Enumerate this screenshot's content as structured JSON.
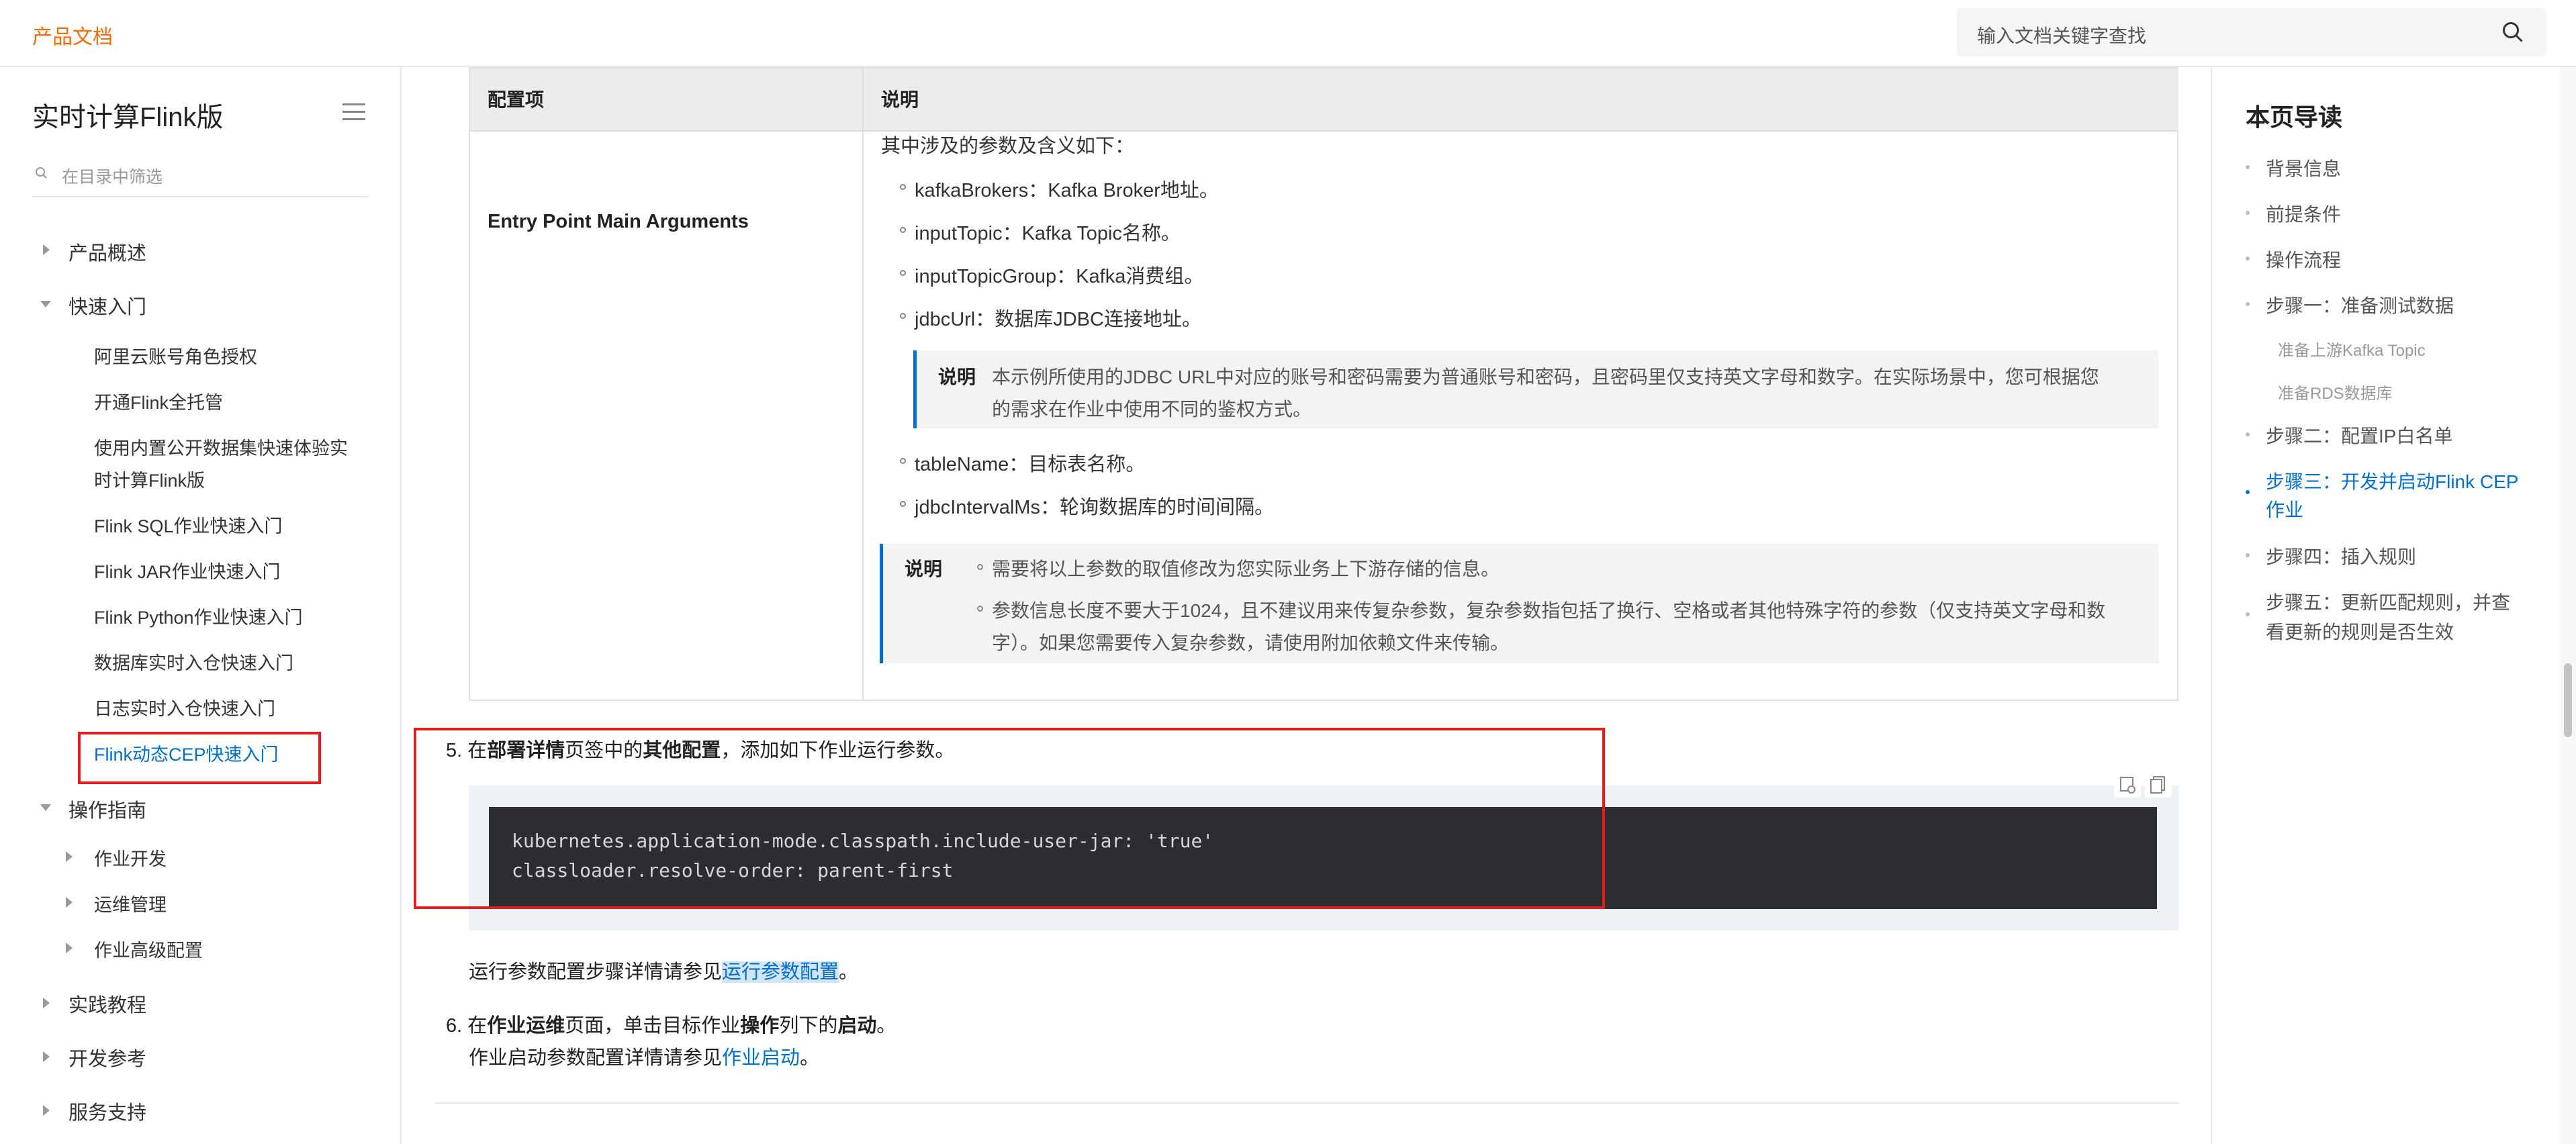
{
  "topbar": {
    "brand": "产品文档",
    "search_placeholder": "输入文档关键字查找"
  },
  "sidebar": {
    "title": "实时计算Flink版",
    "filter_placeholder": "在目录中筛选",
    "items": [
      {
        "label": "产品概述"
      },
      {
        "label": "快速入门"
      },
      {
        "label": "阿里云账号角色授权"
      },
      {
        "label": "开通Flink全托管"
      },
      {
        "label": "使用内置公开数据集快速体验实"
      },
      {
        "label": "时计算Flink版"
      },
      {
        "label": "Flink SQL作业快速入门"
      },
      {
        "label": "Flink JAR作业快速入门"
      },
      {
        "label": "Flink Python作业快速入门"
      },
      {
        "label": "数据库实时入仓快速入门"
      },
      {
        "label": "日志实时入仓快速入门"
      },
      {
        "label": "Flink动态CEP快速入门"
      },
      {
        "label": "操作指南"
      },
      {
        "label": "作业开发"
      },
      {
        "label": "运维管理"
      },
      {
        "label": "作业高级配置"
      },
      {
        "label": "实践教程"
      },
      {
        "label": "开发参考"
      },
      {
        "label": "服务支持"
      }
    ]
  },
  "table": {
    "header_col1": "配置项",
    "header_col2": "说明",
    "row_label": "Entry Point Main Arguments",
    "intro": "其中涉及的参数及含义如下：",
    "params": [
      "kafkaBrokers：Kafka Broker地址。",
      "inputTopic：Kafka Topic名称。",
      "inputTopicGroup：Kafka消费组。",
      "jdbcUrl：数据库JDBC连接地址。",
      "tableName：目标表名称。",
      "jdbcIntervalMs：轮询数据库的时间间隔。"
    ],
    "note1_label": "说明",
    "note1_lines": [
      "本示例所使用的JDBC URL中对应的账号和密码需要为普通账号和密码，且密码里仅支持英文字母和数字。在实际场景中，您可根据您",
      "的需求在作业中使用不同的鉴权方式。"
    ],
    "note2_label": "说明",
    "note2_lines": [
      "需要将以上参数的取值修改为您实际业务上下游存储的信息。",
      "参数信息长度不要大于1024，且不建议用来传复杂参数，复杂参数指包括了换行、空格或者其他特殊字符的参数（仅支持英文字母和数",
      "字）。如果您需要传入复杂参数，请使用附加依赖文件来传输。"
    ]
  },
  "step5": {
    "num": "5.",
    "t1": "在",
    "b1": "部署详情",
    "t2": "页签中的",
    "b2": "其他配置",
    "t3": "，添加如下作业运行参数。"
  },
  "code": {
    "line1": "kubernetes.application-mode.classpath.include-user-jar: 'true'",
    "line2": "classloader.resolve-order: parent-first"
  },
  "run_ref": {
    "text": "运行参数配置步骤详情请参见",
    "link": "运行参数配置",
    "end": "。"
  },
  "step6": {
    "num": "6.",
    "t1": "在",
    "b1": "作业运维",
    "t2": "页面，单击目标作业",
    "b2": "操作",
    "t3": "列下的",
    "b3": "启动",
    "t4": "。",
    "ref_text": "作业启动参数配置详情请参见",
    "ref_link": "作业启动",
    "ref_end": "。"
  },
  "toc": {
    "title": "本页导读",
    "items": [
      "背景信息",
      "前提条件",
      "操作流程",
      "步骤一：准备测试数据",
      "准备上游Kafka Topic",
      "准备RDS数据库",
      "步骤二：配置IP白名单",
      "步骤三：开发并启动Flink CEP",
      "作业",
      "步骤四：插入规则",
      "步骤五：更新匹配规则，并查",
      "看更新的规则是否生效"
    ]
  },
  "colors": {
    "brand": "#ff6a00",
    "link": "#0070cc",
    "highlight_box": "#e02020",
    "code_bg": "#2b2d33"
  }
}
